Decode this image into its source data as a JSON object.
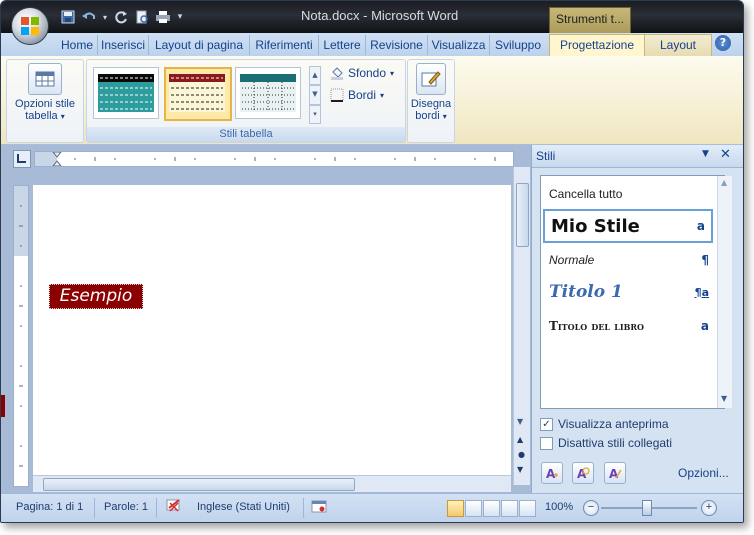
{
  "window": {
    "title": "Nota.docx - Microsoft Word",
    "context_tab_title": "Strumenti t..."
  },
  "tabs": [
    {
      "label": "Home"
    },
    {
      "label": "Inserisci"
    },
    {
      "label": "Layout di pagina"
    },
    {
      "label": "Riferimenti"
    },
    {
      "label": "Lettere"
    },
    {
      "label": "Revisione"
    },
    {
      "label": "Visualizza"
    },
    {
      "label": "Sviluppo"
    },
    {
      "label": "Progettazione",
      "active": true
    },
    {
      "label": "Layout"
    }
  ],
  "ribbon": {
    "opzioni_label_1": "Opzioni stile",
    "opzioni_label_2": "tabella",
    "gallery_group_label": "Stili tabella",
    "sfondo_label": "Sfondo",
    "bordi_label": "Bordi",
    "disegna_label_1": "Disegna",
    "disegna_label_2": "bordi"
  },
  "document": {
    "sample_text": "Esempio",
    "sample_bg": "#8b0000"
  },
  "styles_pane": {
    "title": "Stili",
    "items": [
      {
        "name": "Cancella tutto",
        "mark": ""
      },
      {
        "name": "Mio Stile",
        "mark": "a"
      },
      {
        "name": "Normale",
        "mark": "¶"
      },
      {
        "name": "Titolo 1",
        "mark": "¶a"
      },
      {
        "name": "Titolo del libro",
        "mark": "a"
      }
    ],
    "show_preview_label": "Visualizza anteprima",
    "show_preview_checked": true,
    "disable_linked_label": "Disattiva stili collegati",
    "disable_linked_checked": false,
    "options_label": "Opzioni..."
  },
  "status_bar": {
    "page": "Pagina: 1 di 1",
    "words": "Parole: 1",
    "language": "Inglese (Stati Uniti)",
    "zoom": "100%"
  },
  "colors": {
    "accent": "#15428b",
    "sample_red": "#8b0000"
  }
}
